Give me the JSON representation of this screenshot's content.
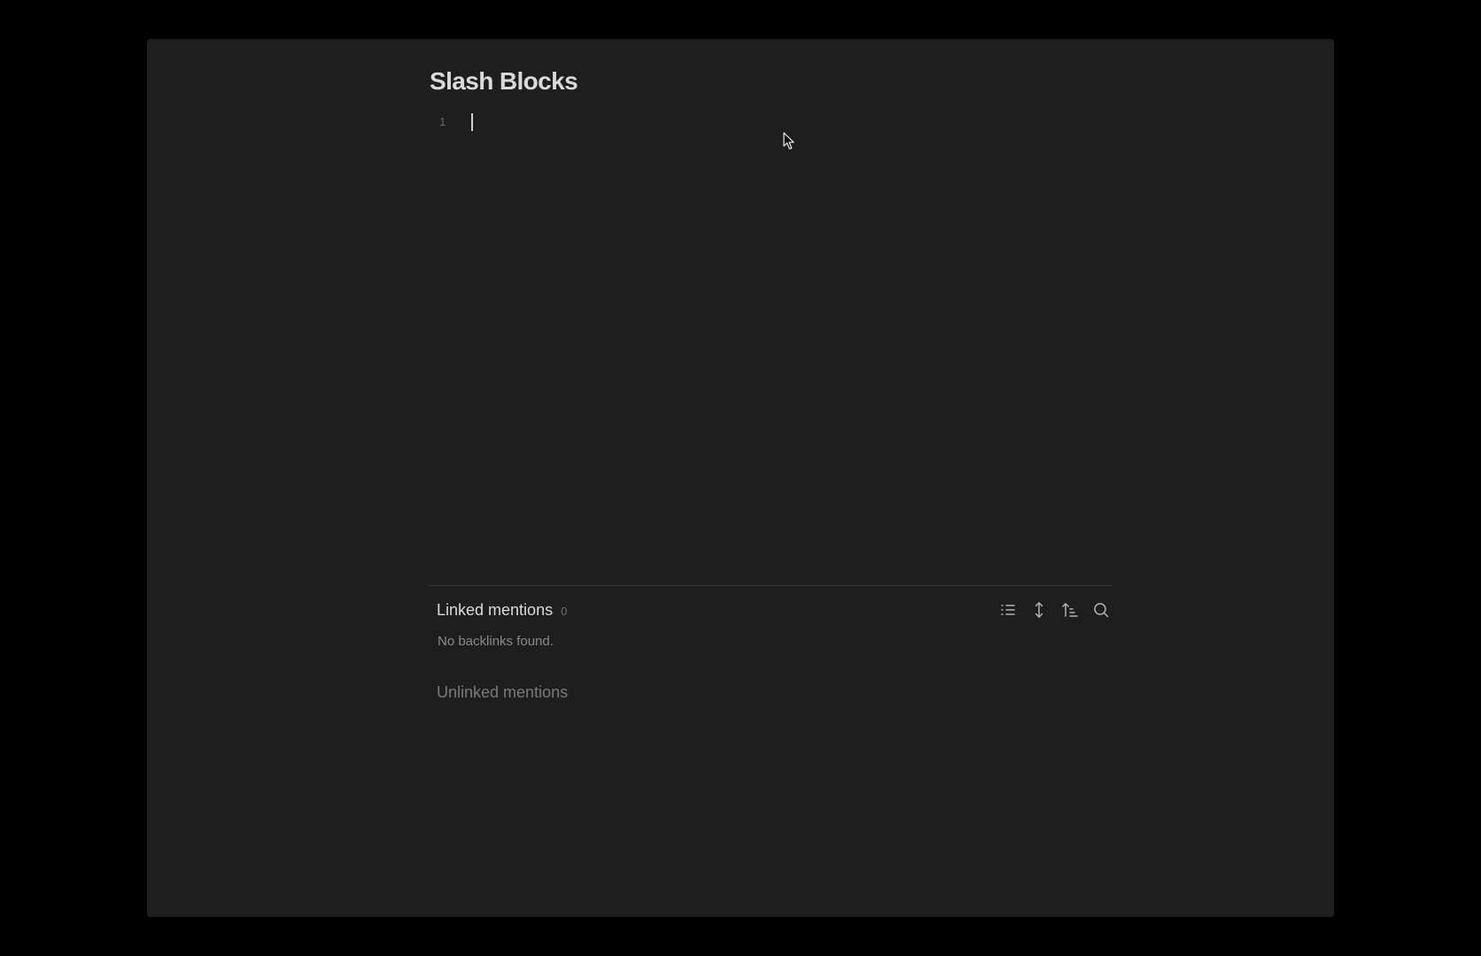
{
  "note": {
    "title": "Slash Blocks",
    "lines": [
      {
        "number": "1",
        "text": ""
      }
    ]
  },
  "backlinks": {
    "linked": {
      "title": "Linked mentions",
      "count": "0",
      "empty_message": "No backlinks found."
    },
    "unlinked": {
      "title": "Unlinked mentions"
    },
    "toolbar": [
      {
        "id": "collapse-results",
        "icon": "list-icon"
      },
      {
        "id": "show-more-context",
        "icon": "vertical-arrows-icon"
      },
      {
        "id": "change-sort-order",
        "icon": "sort-icon"
      },
      {
        "id": "show-search-filter",
        "icon": "search-icon"
      }
    ]
  },
  "colors": {
    "background": "#000000",
    "window": "#1e1e1e",
    "title_text": "#dadada",
    "muted_text": "#8a8a8a",
    "divider": "#363636",
    "icon": "#b4b4b4"
  }
}
